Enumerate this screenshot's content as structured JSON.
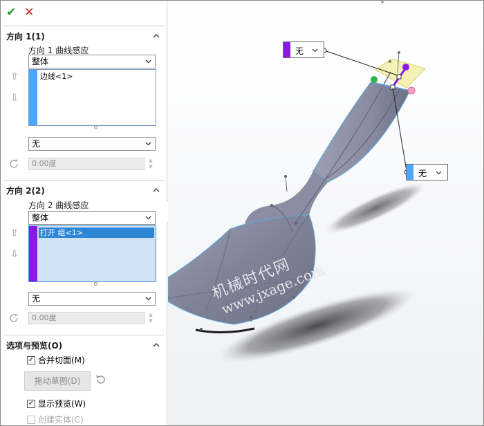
{
  "actions": {
    "ok_glyph": "✔",
    "cancel_glyph": "✕"
  },
  "direction1": {
    "title": "方向 1(1)",
    "sub_label": "方向 1 曲线感应",
    "mode": "整体",
    "selection_item": "边线<1>",
    "tangent": "无",
    "angle": "0.00度",
    "color": "#4da6ff"
  },
  "direction2": {
    "title": "方向 2(2)",
    "sub_label": "方向 2 曲线感应",
    "mode": "整体",
    "selection_item": "打开 组<1>",
    "tangent": "无",
    "angle": "0.00度",
    "color": "#8a19e6"
  },
  "options": {
    "title": "选项与预览(O)",
    "merge_faces": {
      "label": "合并切面(M)",
      "checked": true
    },
    "drag_sketch_label": "拖动草图(D)",
    "show_preview": {
      "label": "显示预览(W)",
      "checked": true
    },
    "create_solid": {
      "label": "创建实体(C)",
      "checked": false,
      "enabled": false
    }
  },
  "viewport": {
    "callout_top": {
      "value": "无",
      "color": "#8a19e6"
    },
    "callout_right": {
      "value": "无",
      "color": "#4da6ff"
    },
    "watermark_line1": "机械时代网",
    "watermark_line2": "www.jxage.com"
  }
}
